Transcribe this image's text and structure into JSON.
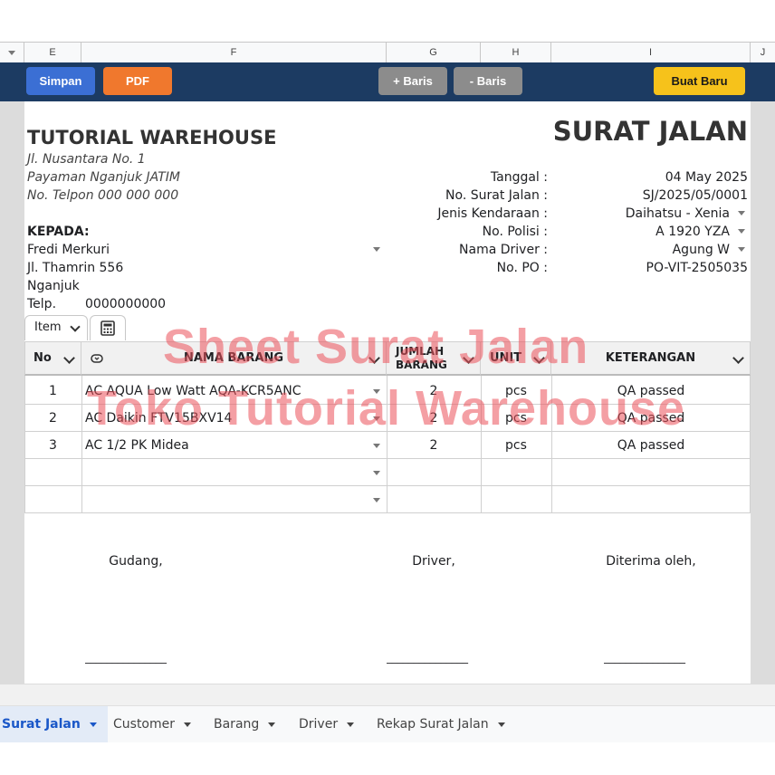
{
  "columns": [
    "E",
    "F",
    "G",
    "H",
    "I",
    "J"
  ],
  "toolbar": {
    "save_label": "Simpan",
    "pdf_label": "PDF",
    "add_row_label": "+ Baris",
    "remove_row_label": "- Baris",
    "new_label": "Buat Baru",
    "colors": {
      "bar": "#1c3b62",
      "save": "#3b6fd4",
      "pdf": "#f0782d",
      "row": "#8c8c8c",
      "new": "#f6c21b"
    }
  },
  "company": {
    "name": "TUTORIAL WAREHOUSE",
    "address1": "Jl. Nusantara No. 1",
    "address2": "Payaman Nganjuk JATIM",
    "phone": "No. Telpon 000 000 000"
  },
  "doc_title": "SURAT JALAN",
  "recipient": {
    "heading": "KEPADA:",
    "name": "Fredi Merkuri",
    "address": "Jl. Thamrin 556",
    "city": "Nganjuk",
    "phone_label": "Telp.",
    "phone": "0000000000"
  },
  "details": [
    {
      "label": "Tanggal :",
      "value": "04 May 2025"
    },
    {
      "label": "No. Surat Jalan :",
      "value": "SJ/2025/05/0001"
    },
    {
      "label": "Jenis Kendaraan :",
      "value": "Daihatsu - Xenia"
    },
    {
      "label": "No. Polisi :",
      "value": "A 1920 YZA"
    },
    {
      "label": "Nama Driver :",
      "value": "Agung W"
    },
    {
      "label": "No. PO :",
      "value": "PO-VIT-2505035"
    }
  ],
  "view_tabs": {
    "item_label": "Item",
    "calc_icon": "calculator-icon"
  },
  "table": {
    "headers": {
      "no": "No",
      "nama": "NAMA BARANG",
      "jumlah": "JUMLAH\nBARANG",
      "unit": "UNIT",
      "ket": "KETERANGAN"
    },
    "rows": [
      {
        "no": "1",
        "nama": "AC AQUA Low Watt AQA-KCR5ANC",
        "jumlah": "2",
        "unit": "pcs",
        "ket": "QA passed"
      },
      {
        "no": "2",
        "nama": "AC Daikin FTV15BXV14",
        "jumlah": "2",
        "unit": "pcs",
        "ket": "QA passed"
      },
      {
        "no": "3",
        "nama": "AC 1/2 PK Midea",
        "jumlah": "2",
        "unit": "pcs",
        "ket": "QA passed"
      },
      {
        "no": "",
        "nama": "",
        "jumlah": "",
        "unit": "",
        "ket": ""
      },
      {
        "no": "",
        "nama": "",
        "jumlah": "",
        "unit": "",
        "ket": ""
      }
    ]
  },
  "watermark": {
    "line1": "Sheet Surat Jalan",
    "line2": "Toko Tutorial Warehouse"
  },
  "signatures": {
    "warehouse": "Gudang,",
    "driver": "Driver,",
    "receiver": "Diterima oleh,",
    "line": "_______________"
  },
  "sheet_tabs": [
    {
      "label": "Surat Jalan",
      "active": true
    },
    {
      "label": "Customer",
      "active": false
    },
    {
      "label": "Barang",
      "active": false
    },
    {
      "label": "Driver",
      "active": false
    },
    {
      "label": "Rekap Surat Jalan",
      "active": false
    }
  ]
}
